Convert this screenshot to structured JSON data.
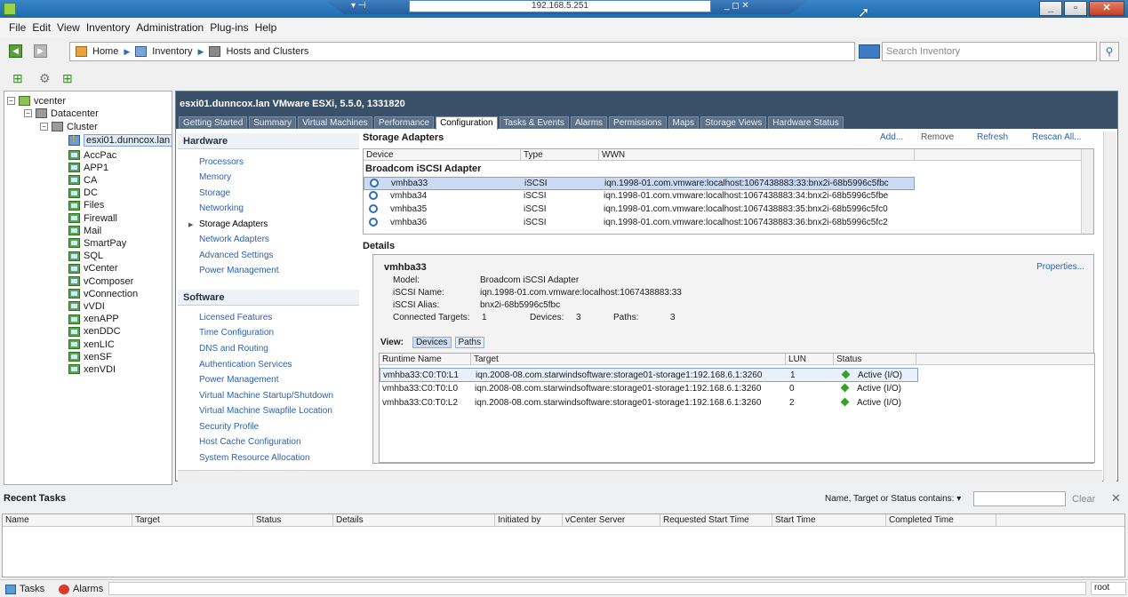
{
  "titlebar": {
    "remote_ip": "192.168.5.251"
  },
  "menu": [
    "File",
    "Edit",
    "View",
    "Inventory",
    "Administration",
    "Plug-ins",
    "Help"
  ],
  "breadcrumb": {
    "home": "Home",
    "inventory": "Inventory",
    "hosts": "Hosts and Clusters"
  },
  "search": {
    "placeholder": "Search Inventory"
  },
  "tree": {
    "root": "vcenter",
    "datacenter": "Datacenter",
    "cluster": "Cluster",
    "host": "esxi01.dunncox.lan",
    "vms": [
      "AccPac",
      "APP1",
      "CA",
      "DC",
      "Files",
      "Firewall",
      "Mail",
      "SmartPay",
      "SQL",
      "vCenter",
      "vComposer",
      "vConnection",
      "vVDI",
      "xenAPP",
      "xenDDC",
      "xenLIC",
      "xenSF",
      "xenVDI"
    ]
  },
  "host_header": {
    "title": "esxi01.dunncox.lan VMware ESXi, 5.5.0, 1331820"
  },
  "tabs": [
    "Getting Started",
    "Summary",
    "Virtual Machines",
    "Performance",
    "Configuration",
    "Tasks & Events",
    "Alarms",
    "Permissions",
    "Maps",
    "Storage Views",
    "Hardware Status"
  ],
  "hardware": {
    "title": "Hardware",
    "items": [
      "Processors",
      "Memory",
      "Storage",
      "Networking",
      "Storage Adapters",
      "Network Adapters",
      "Advanced Settings",
      "Power Management"
    ]
  },
  "software": {
    "title": "Software",
    "items": [
      "Licensed Features",
      "Time Configuration",
      "DNS and Routing",
      "Authentication Services",
      "Power Management",
      "Virtual Machine Startup/Shutdown",
      "Virtual Machine Swapfile Location",
      "Security Profile",
      "Host Cache Configuration",
      "System Resource Allocation"
    ]
  },
  "storage_adapters": {
    "title": "Storage Adapters",
    "actions": {
      "add": "Add...",
      "remove": "Remove",
      "refresh": "Refresh",
      "rescan": "Rescan All..."
    },
    "columns": [
      "Device",
      "Type",
      "WWN"
    ],
    "group": "Broadcom iSCSI Adapter",
    "rows": [
      {
        "device": "vmhba33",
        "type": "iSCSI",
        "wwn": "iqn.1998-01.com.vmware:localhost:1067438883:33:bnx2i-68b5996c5fbc"
      },
      {
        "device": "vmhba34",
        "type": "iSCSI",
        "wwn": "iqn.1998-01.com.vmware:localhost:1067438883:34:bnx2i-68b5996c5fbe"
      },
      {
        "device": "vmhba35",
        "type": "iSCSI",
        "wwn": "iqn.1998-01.com.vmware:localhost:1067438883:35:bnx2i-68b5996c5fc0"
      },
      {
        "device": "vmhba36",
        "type": "iSCSI",
        "wwn": "iqn.1998-01.com.vmware:localhost:1067438883:36:bnx2i-68b5996c5fc2"
      }
    ]
  },
  "details": {
    "title": "Details",
    "name": "vmhba33",
    "properties": "Properties...",
    "model_label": "Model:",
    "model": "Broadcom iSCSI Adapter",
    "iscsi_name_label": "iSCSI Name:",
    "iscsi_name": "iqn.1998-01.com.vmware:localhost:1067438883:33",
    "iscsi_alias_label": "iSCSI Alias:",
    "iscsi_alias": "bnx2i-68b5996c5fbc",
    "targets_label": "Connected Targets:",
    "targets": "1",
    "devices_label": "Devices:",
    "devices": "3",
    "paths_label": "Paths:",
    "paths": "3",
    "view_label": "View:",
    "view_devices": "Devices",
    "view_paths": "Paths",
    "path_columns": [
      "Runtime Name",
      "Target",
      "LUN",
      "Status"
    ],
    "path_rows": [
      {
        "runtime": "vmhba33:C0:T0:L1",
        "target": "iqn.2008-08.com.starwindsoftware:storage01-storage1:192.168.6.1:3260",
        "lun": "1",
        "status": "Active (I/O)"
      },
      {
        "runtime": "vmhba33:C0:T0:L0",
        "target": "iqn.2008-08.com.starwindsoftware:storage01-storage1:192.168.6.1:3260",
        "lun": "0",
        "status": "Active (I/O)"
      },
      {
        "runtime": "vmhba33:C0:T0:L2",
        "target": "iqn.2008-08.com.starwindsoftware:storage01-storage1:192.168.6.1:3260",
        "lun": "2",
        "status": "Active (I/O)"
      }
    ]
  },
  "recent_tasks": {
    "title": "Recent Tasks",
    "filter_label": "Name, Target or Status contains: ▾",
    "clear": "Clear",
    "columns": [
      "Name",
      "Target",
      "Status",
      "Details",
      "Initiated by",
      "vCenter Server",
      "Requested Start Time",
      "Start Time",
      "Completed Time"
    ]
  },
  "statusbar": {
    "tasks": "Tasks",
    "alarms": "Alarms",
    "user": "root"
  }
}
